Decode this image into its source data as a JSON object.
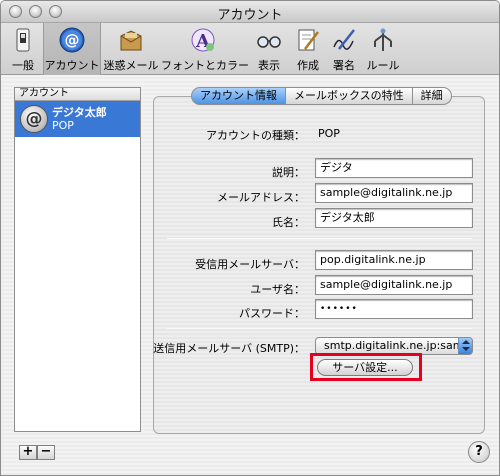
{
  "window": {
    "title": "アカウント"
  },
  "toolbar": {
    "items": [
      {
        "label": "一般",
        "icon": "switch-icon"
      },
      {
        "label": "アカウント",
        "icon": "at-sign-icon"
      },
      {
        "label": "迷惑メール",
        "icon": "junk-mail-icon"
      },
      {
        "label": "フォントとカラー",
        "icon": "font-color-icon"
      },
      {
        "label": "表示",
        "icon": "glasses-icon"
      },
      {
        "label": "作成",
        "icon": "compose-icon"
      },
      {
        "label": "署名",
        "icon": "signature-icon"
      },
      {
        "label": "ルール",
        "icon": "rules-icon"
      }
    ],
    "selected": "アカウント"
  },
  "sidebar": {
    "header": "アカウント",
    "accounts": [
      {
        "name": "デジタ太郎",
        "type": "POP"
      }
    ],
    "add_label": "+",
    "remove_label": "−"
  },
  "tabs": {
    "items": [
      "アカウント情報",
      "メールボックスの特性",
      "詳細"
    ],
    "active": "アカウント情報"
  },
  "form": {
    "account_type_label": "アカウントの種類：",
    "account_type_value": "POP",
    "description_label": "説明：",
    "description_value": "デジタ",
    "email_label": "メールアドレス：",
    "email_value": "sample@digitalink.ne.jp",
    "fullname_label": "氏名：",
    "fullname_value": "デジタ太郎",
    "incoming_label": "受信用メールサーバ：",
    "incoming_value": "pop.digitalink.ne.jp",
    "username_label": "ユーザ名：",
    "username_value": "sample@digitalink.ne.jp",
    "password_label": "パスワード：",
    "password_value": "••••••",
    "smtp_label": "送信用メールサーバ (SMTP)：",
    "smtp_value": "smtp.digitalink.ne.jp:samp",
    "server_settings_button": "サーバ設定..."
  },
  "help": {
    "label": "?"
  },
  "colors": {
    "highlight": "#e4001f",
    "selection": "#3a78d6"
  }
}
